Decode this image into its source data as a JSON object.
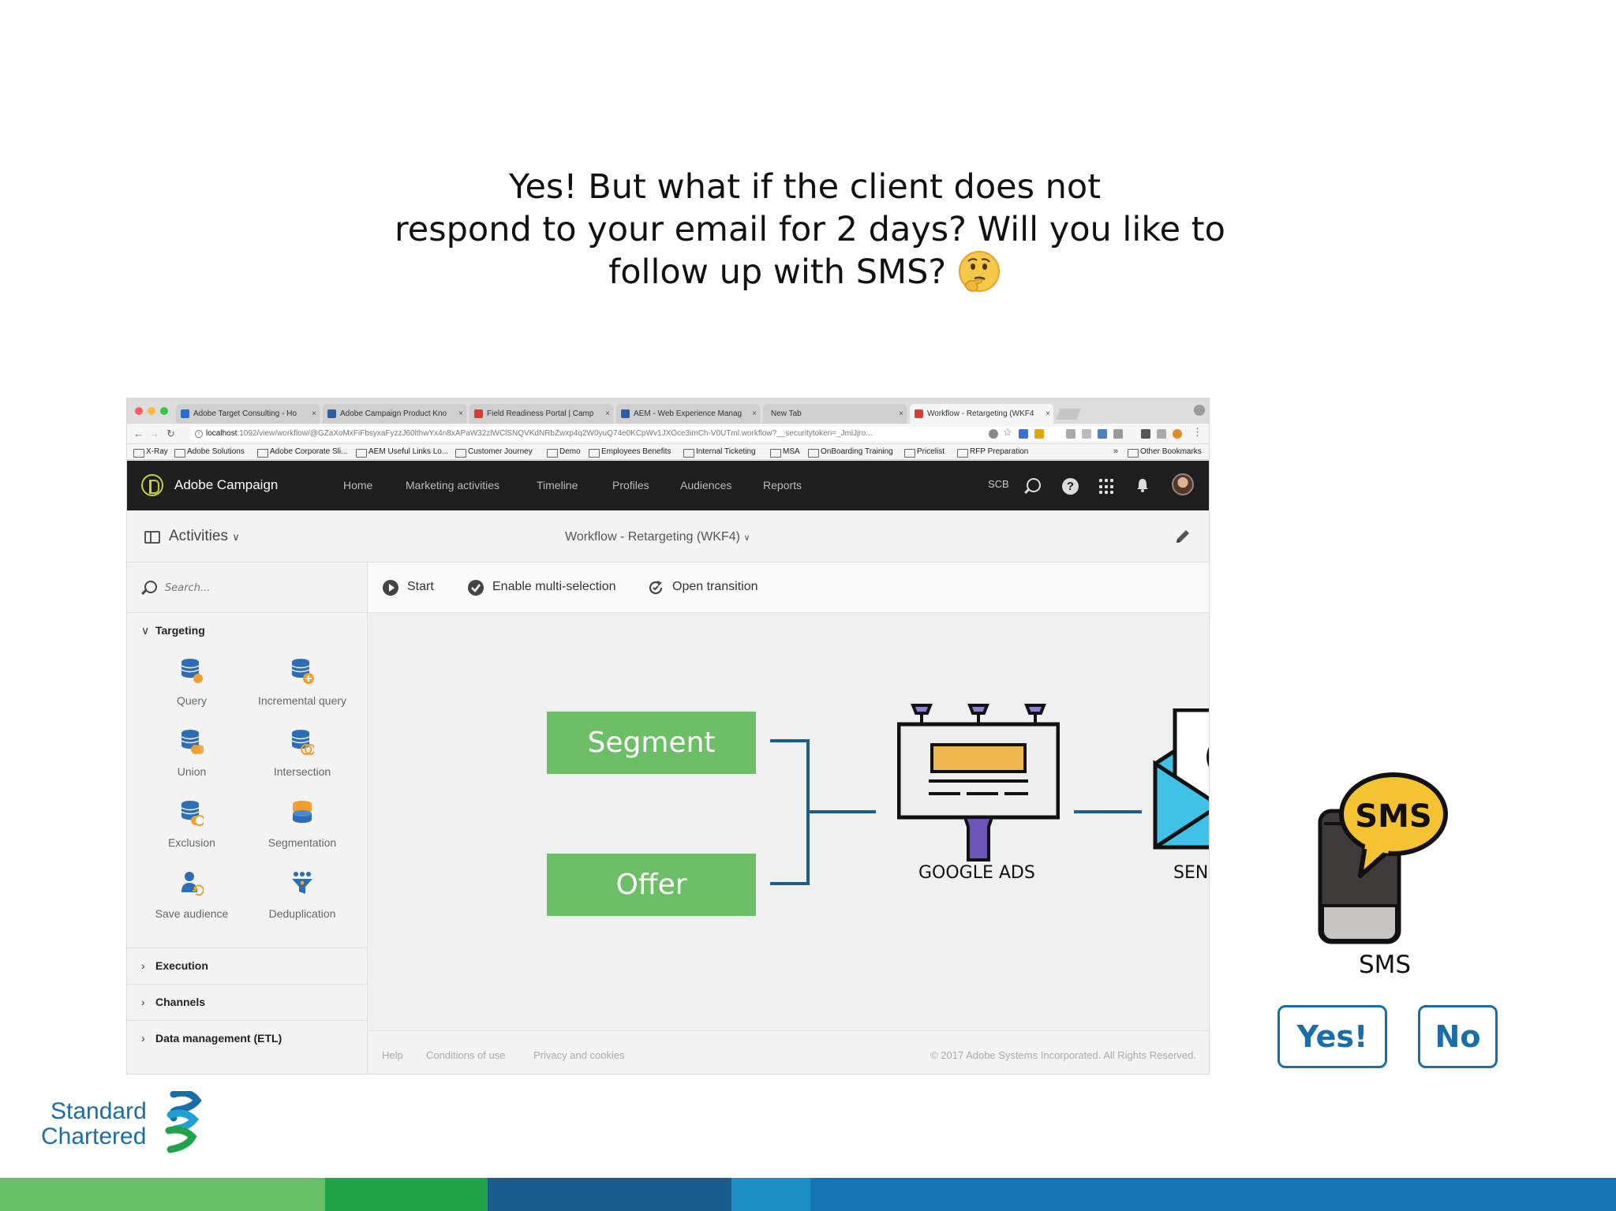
{
  "slide": {
    "headline_lines": [
      "Yes! But what if the client does not",
      "respond to your email for 2 days? Will you like to",
      "follow up with SMS?"
    ]
  },
  "browser": {
    "tabs": [
      {
        "label": "Adobe Target Consulting - Ho",
        "color": "#1e6fd9"
      },
      {
        "label": "Adobe Campaign Product Kno",
        "color": "#2c5ea8"
      },
      {
        "label": "Field Readiness Portal | Camp",
        "color": "#e03a2f"
      },
      {
        "label": "AEM - Web Experience Manag",
        "color": "#2c5ea8"
      },
      {
        "label": "New Tab",
        "color": ""
      },
      {
        "label": "Workflow - Retargeting (WKF4",
        "color": "#e03a2f"
      }
    ],
    "url_host": "localhost",
    "url_rest": ":1092/view/workflow/@GZaXoMxFiFbsyxaFyzzJ60lthwYx4n8xAPaW32zlWClSNQVKdNRbZwxp4q2W0yuQ74e0KCpWv1JXOce3imCh-V0UTml.workflow?__securitytoken=_JmlJjro...",
    "bookmarks": [
      "X-Ray",
      "Adobe Solutions",
      "Adobe Corporate Sli...",
      "AEM Useful Links Lo...",
      "Customer Journey",
      "Demo",
      "Employees Benefits",
      "Internal Ticketing",
      "MSA",
      "OnBoarding Training",
      "Pricelist",
      "RFP Preparation"
    ],
    "bookmarks_more": "»",
    "other_bookmarks": "Other Bookmarks"
  },
  "app": {
    "title": "Adobe Campaign",
    "nav": [
      "Home",
      "Marketing activities",
      "Timeline",
      "Profiles",
      "Audiences",
      "Reports"
    ],
    "org": "SCB",
    "help_glyph": "?",
    "activities_label": "Activities",
    "workflow_title": "Workflow - Retargeting (WKF4)",
    "search_placeholder": "Search...",
    "sections": {
      "targeting": "Targeting",
      "execution": "Execution",
      "channels": "Channels",
      "data_management": "Data management (ETL)"
    },
    "activities": [
      "Query",
      "Incremental query",
      "Union",
      "Intersection",
      "Exclusion",
      "Segmentation",
      "Save audience",
      "Deduplication"
    ],
    "toolbar": {
      "start": "Start",
      "multi": "Enable multi-selection",
      "transition": "Open transition"
    },
    "canvas": {
      "segment": "Segment",
      "offer": "Offer",
      "google_ads": "GOOGLE ADS",
      "send_email": "SEND EMAIL"
    },
    "footer": {
      "help": "Help",
      "conditions": "Conditions of use",
      "privacy": "Privacy and cookies",
      "copyright": "© 2017 Adobe Systems Incorporated. All Rights Reserved."
    }
  },
  "right": {
    "sms_bubble": "SMS",
    "sms_label": "SMS",
    "yes_button": "Yes!",
    "no_button": "No"
  },
  "logo": {
    "line1": "Standard",
    "line2": "Chartered"
  },
  "colors": {
    "accent_blue": "#1a6ea8",
    "segment_green": "#6dbf67",
    "band": [
      "#6abf69",
      "#22a24b",
      "#1a5c8c",
      "#1e8fc2",
      "#1674b5"
    ]
  }
}
